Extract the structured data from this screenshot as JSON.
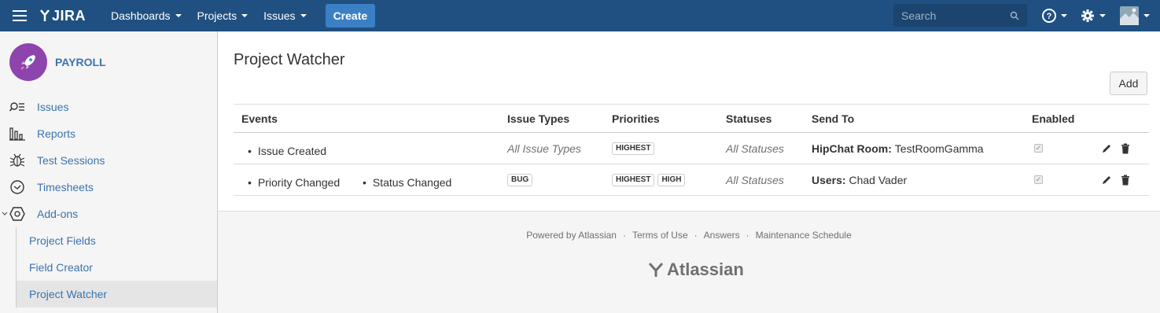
{
  "header": {
    "logo_text": "JIRA",
    "menus": [
      "Dashboards",
      "Projects",
      "Issues"
    ],
    "create_label": "Create",
    "search_placeholder": "Search"
  },
  "sidebar": {
    "project_name": "PAYROLL",
    "items": [
      {
        "label": "Issues",
        "icon": "search-list-icon"
      },
      {
        "label": "Reports",
        "icon": "bar-chart-icon"
      },
      {
        "label": "Test Sessions",
        "icon": "bug-icon"
      },
      {
        "label": "Timesheets",
        "icon": "clock-icon"
      },
      {
        "label": "Add-ons",
        "icon": "hexagon-icon"
      }
    ],
    "subitems": [
      "Project Fields",
      "Field Creator",
      "Project Watcher"
    ]
  },
  "main": {
    "title": "Project Watcher",
    "add_label": "Add",
    "columns": [
      "Events",
      "Issue Types",
      "Priorities",
      "Statuses",
      "Send To",
      "Enabled"
    ],
    "rows": [
      {
        "events": [
          "Issue Created"
        ],
        "issue_types_text": "All Issue Types",
        "priorities": [
          "HIGHEST"
        ],
        "statuses": "All Statuses",
        "send_to_label": "HipChat Room:",
        "send_to_value": "TestRoomGamma"
      },
      {
        "events": [
          "Priority Changed",
          "Status Changed"
        ],
        "issue_type_lozenge": "BUG",
        "priorities": [
          "HIGHEST",
          "HIGH"
        ],
        "statuses": "All Statuses",
        "send_to_label": "Users:",
        "send_to_value": "Chad Vader"
      }
    ]
  },
  "footer": {
    "links": [
      "Powered by Atlassian",
      "Terms of Use",
      "Answers",
      "Maintenance Schedule"
    ],
    "logo_text": "Atlassian",
    "separator": "·"
  },
  "colors": {
    "header_bg": "#205081",
    "link": "#3b73af",
    "create_button": "#3b7fc4"
  }
}
